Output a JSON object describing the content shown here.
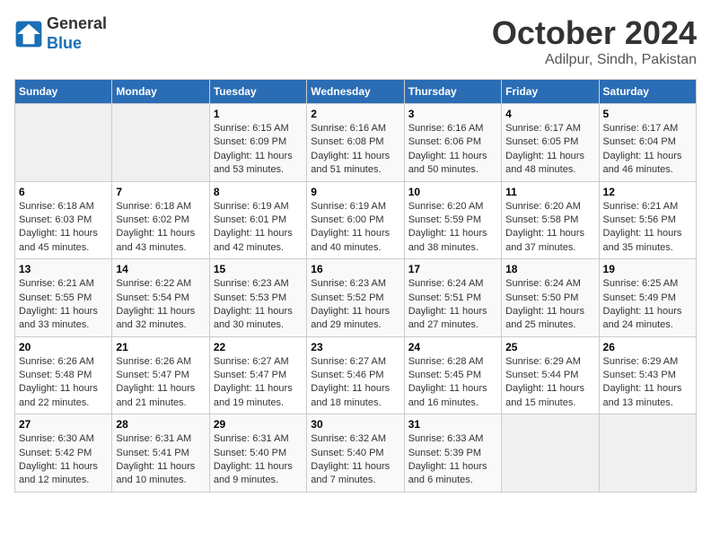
{
  "header": {
    "logo_line1": "General",
    "logo_line2": "Blue",
    "month": "October 2024",
    "location": "Adilpur, Sindh, Pakistan"
  },
  "weekdays": [
    "Sunday",
    "Monday",
    "Tuesday",
    "Wednesday",
    "Thursday",
    "Friday",
    "Saturday"
  ],
  "weeks": [
    [
      {
        "day": "",
        "empty": true
      },
      {
        "day": "",
        "empty": true
      },
      {
        "day": "1",
        "sunrise": "6:15 AM",
        "sunset": "6:09 PM",
        "daylight": "11 hours and 53 minutes."
      },
      {
        "day": "2",
        "sunrise": "6:16 AM",
        "sunset": "6:08 PM",
        "daylight": "11 hours and 51 minutes."
      },
      {
        "day": "3",
        "sunrise": "6:16 AM",
        "sunset": "6:06 PM",
        "daylight": "11 hours and 50 minutes."
      },
      {
        "day": "4",
        "sunrise": "6:17 AM",
        "sunset": "6:05 PM",
        "daylight": "11 hours and 48 minutes."
      },
      {
        "day": "5",
        "sunrise": "6:17 AM",
        "sunset": "6:04 PM",
        "daylight": "11 hours and 46 minutes."
      }
    ],
    [
      {
        "day": "6",
        "sunrise": "6:18 AM",
        "sunset": "6:03 PM",
        "daylight": "11 hours and 45 minutes."
      },
      {
        "day": "7",
        "sunrise": "6:18 AM",
        "sunset": "6:02 PM",
        "daylight": "11 hours and 43 minutes."
      },
      {
        "day": "8",
        "sunrise": "6:19 AM",
        "sunset": "6:01 PM",
        "daylight": "11 hours and 42 minutes."
      },
      {
        "day": "9",
        "sunrise": "6:19 AM",
        "sunset": "6:00 PM",
        "daylight": "11 hours and 40 minutes."
      },
      {
        "day": "10",
        "sunrise": "6:20 AM",
        "sunset": "5:59 PM",
        "daylight": "11 hours and 38 minutes."
      },
      {
        "day": "11",
        "sunrise": "6:20 AM",
        "sunset": "5:58 PM",
        "daylight": "11 hours and 37 minutes."
      },
      {
        "day": "12",
        "sunrise": "6:21 AM",
        "sunset": "5:56 PM",
        "daylight": "11 hours and 35 minutes."
      }
    ],
    [
      {
        "day": "13",
        "sunrise": "6:21 AM",
        "sunset": "5:55 PM",
        "daylight": "11 hours and 33 minutes."
      },
      {
        "day": "14",
        "sunrise": "6:22 AM",
        "sunset": "5:54 PM",
        "daylight": "11 hours and 32 minutes."
      },
      {
        "day": "15",
        "sunrise": "6:23 AM",
        "sunset": "5:53 PM",
        "daylight": "11 hours and 30 minutes."
      },
      {
        "day": "16",
        "sunrise": "6:23 AM",
        "sunset": "5:52 PM",
        "daylight": "11 hours and 29 minutes."
      },
      {
        "day": "17",
        "sunrise": "6:24 AM",
        "sunset": "5:51 PM",
        "daylight": "11 hours and 27 minutes."
      },
      {
        "day": "18",
        "sunrise": "6:24 AM",
        "sunset": "5:50 PM",
        "daylight": "11 hours and 25 minutes."
      },
      {
        "day": "19",
        "sunrise": "6:25 AM",
        "sunset": "5:49 PM",
        "daylight": "11 hours and 24 minutes."
      }
    ],
    [
      {
        "day": "20",
        "sunrise": "6:26 AM",
        "sunset": "5:48 PM",
        "daylight": "11 hours and 22 minutes."
      },
      {
        "day": "21",
        "sunrise": "6:26 AM",
        "sunset": "5:47 PM",
        "daylight": "11 hours and 21 minutes."
      },
      {
        "day": "22",
        "sunrise": "6:27 AM",
        "sunset": "5:47 PM",
        "daylight": "11 hours and 19 minutes."
      },
      {
        "day": "23",
        "sunrise": "6:27 AM",
        "sunset": "5:46 PM",
        "daylight": "11 hours and 18 minutes."
      },
      {
        "day": "24",
        "sunrise": "6:28 AM",
        "sunset": "5:45 PM",
        "daylight": "11 hours and 16 minutes."
      },
      {
        "day": "25",
        "sunrise": "6:29 AM",
        "sunset": "5:44 PM",
        "daylight": "11 hours and 15 minutes."
      },
      {
        "day": "26",
        "sunrise": "6:29 AM",
        "sunset": "5:43 PM",
        "daylight": "11 hours and 13 minutes."
      }
    ],
    [
      {
        "day": "27",
        "sunrise": "6:30 AM",
        "sunset": "5:42 PM",
        "daylight": "11 hours and 12 minutes."
      },
      {
        "day": "28",
        "sunrise": "6:31 AM",
        "sunset": "5:41 PM",
        "daylight": "11 hours and 10 minutes."
      },
      {
        "day": "29",
        "sunrise": "6:31 AM",
        "sunset": "5:40 PM",
        "daylight": "11 hours and 9 minutes."
      },
      {
        "day": "30",
        "sunrise": "6:32 AM",
        "sunset": "5:40 PM",
        "daylight": "11 hours and 7 minutes."
      },
      {
        "day": "31",
        "sunrise": "6:33 AM",
        "sunset": "5:39 PM",
        "daylight": "11 hours and 6 minutes."
      },
      {
        "day": "",
        "empty": true
      },
      {
        "day": "",
        "empty": true
      }
    ]
  ]
}
